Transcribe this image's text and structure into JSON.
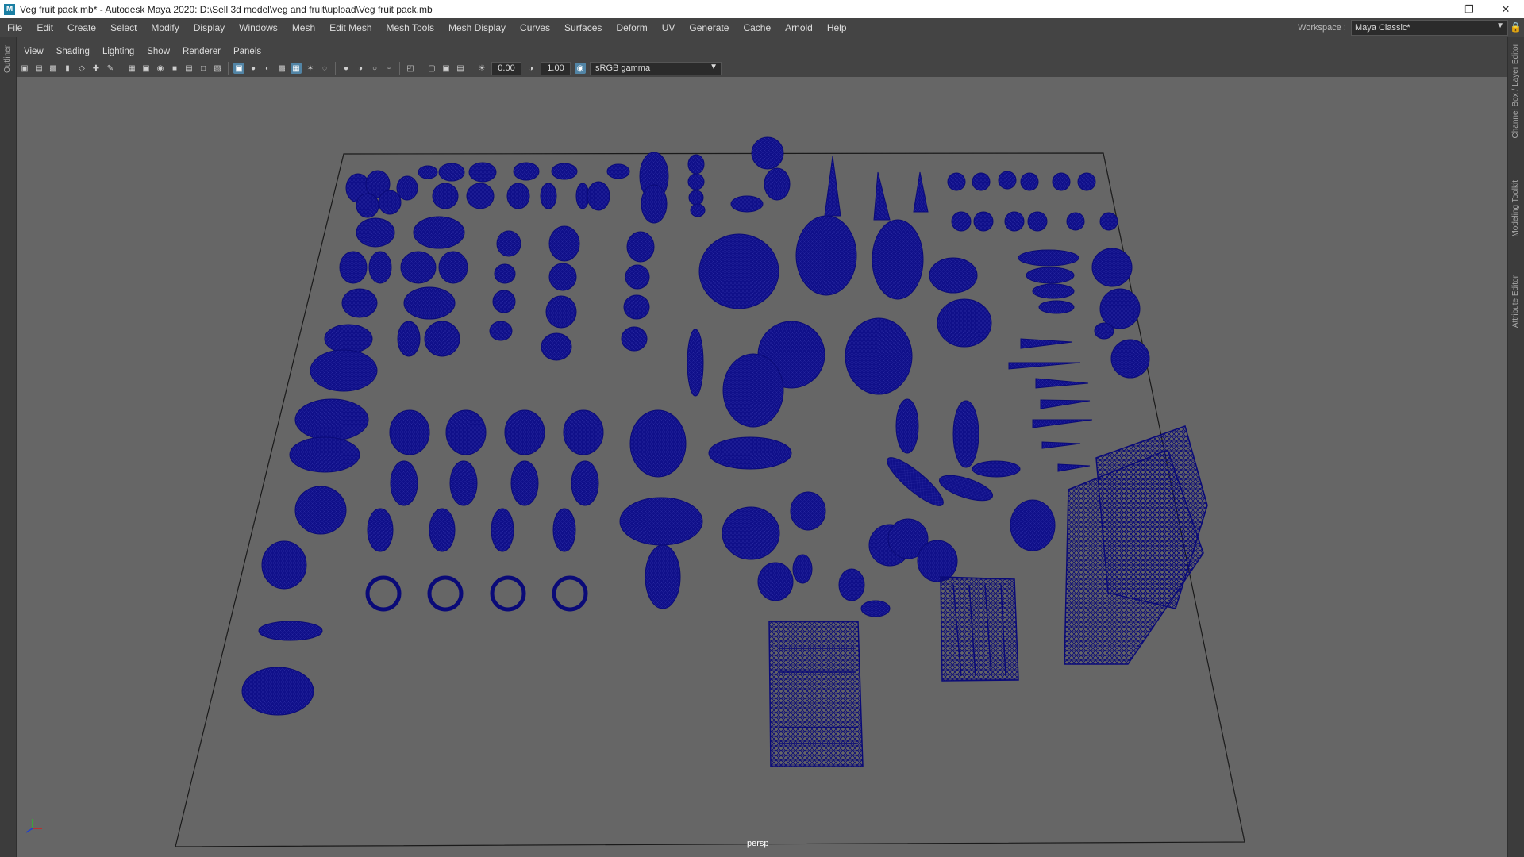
{
  "window": {
    "title": "Veg fruit pack.mb* - Autodesk Maya 2020: D:\\Sell 3d model\\veg and fruit\\upload\\Veg fruit pack.mb",
    "app_icon_glyph": "M"
  },
  "menus": [
    "File",
    "Edit",
    "Create",
    "Select",
    "Modify",
    "Display",
    "Windows",
    "Mesh",
    "Edit Mesh",
    "Mesh Tools",
    "Mesh Display",
    "Curves",
    "Surfaces",
    "Deform",
    "UV",
    "Generate",
    "Cache",
    "Arnold",
    "Help"
  ],
  "workspace": {
    "label": "Workspace :",
    "value": "Maya Classic*"
  },
  "side_tabs": {
    "left": "Outliner",
    "right": [
      "Channel Box / Layer Editor",
      "Modeling Toolkit",
      "Attribute Editor"
    ]
  },
  "panel_menus": [
    "View",
    "Shading",
    "Lighting",
    "Show",
    "Renderer",
    "Panels"
  ],
  "toolbar": {
    "exposure": "0.00",
    "gamma": "1.00",
    "color_management": "sRGB gamma"
  },
  "viewport": {
    "camera": "persp",
    "background_color": "#666666",
    "wireframe_color": "#0a0a78",
    "display_mode": "wireframe"
  }
}
